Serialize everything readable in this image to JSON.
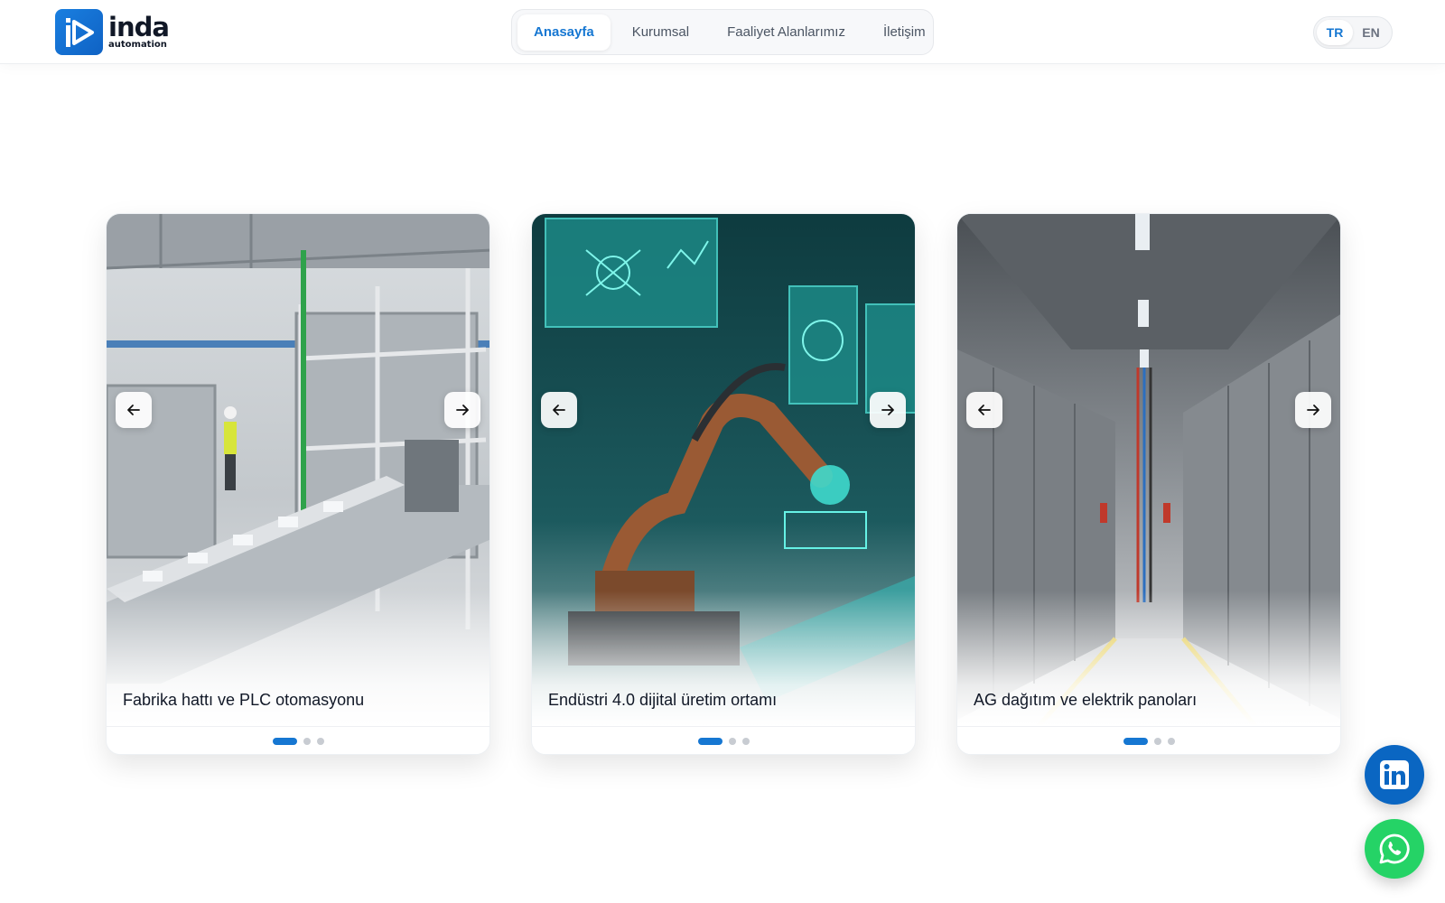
{
  "brand": {
    "name": "inda",
    "subtitle": "automation",
    "logo_icon": "inda-logo-icon",
    "accent_color": "#1677d2"
  },
  "nav": {
    "items": [
      {
        "label": "Anasayfa",
        "active": true
      },
      {
        "label": "Kurumsal",
        "active": false
      },
      {
        "label": "Faaliyet Alanlarımız",
        "active": false
      },
      {
        "label": "İletişim",
        "active": false
      }
    ]
  },
  "language": {
    "options": [
      "TR",
      "EN"
    ],
    "selected": "TR"
  },
  "cards": [
    {
      "caption": "Fabrika hattı ve PLC otomasyonu",
      "slide_count": 3,
      "active_slide": 1,
      "prev_icon": "arrow-left-icon",
      "next_icon": "arrow-right-icon"
    },
    {
      "caption": "Endüstri 4.0 dijital üretim ortamı",
      "slide_count": 3,
      "active_slide": 1,
      "prev_icon": "arrow-left-icon",
      "next_icon": "arrow-right-icon"
    },
    {
      "caption": "AG dağıtım ve elektrik panoları",
      "slide_count": 3,
      "active_slide": 1,
      "prev_icon": "arrow-left-icon",
      "next_icon": "arrow-right-icon"
    }
  ],
  "social": {
    "linkedin_icon": "linkedin-icon",
    "whatsapp_icon": "whatsapp-icon",
    "linkedin_color": "#0a66c2",
    "whatsapp_color": "#25d366"
  }
}
